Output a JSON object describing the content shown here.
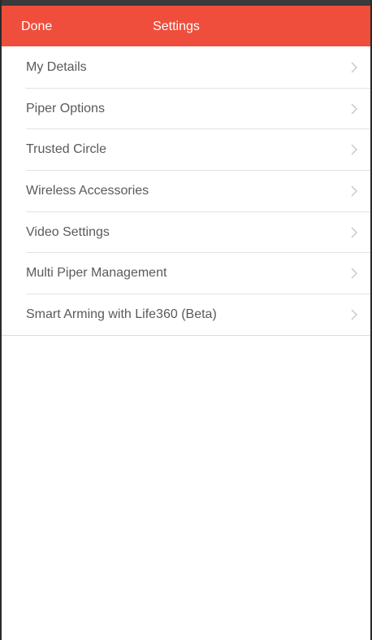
{
  "nav": {
    "done_label": "Done",
    "title": "Settings",
    "accent_color": "#f04e3c"
  },
  "settings": {
    "items": [
      {
        "label": "My Details",
        "icon": "chevron-right-icon"
      },
      {
        "label": "Piper Options",
        "icon": "chevron-right-icon"
      },
      {
        "label": "Trusted Circle",
        "icon": "chevron-right-icon"
      },
      {
        "label": "Wireless Accessories",
        "icon": "chevron-right-icon"
      },
      {
        "label": "Video Settings",
        "icon": "chevron-right-icon"
      },
      {
        "label": "Multi Piper Management",
        "icon": "chevron-right-icon"
      },
      {
        "label": "Smart Arming with Life360 (Beta)",
        "icon": "chevron-right-icon"
      }
    ]
  }
}
